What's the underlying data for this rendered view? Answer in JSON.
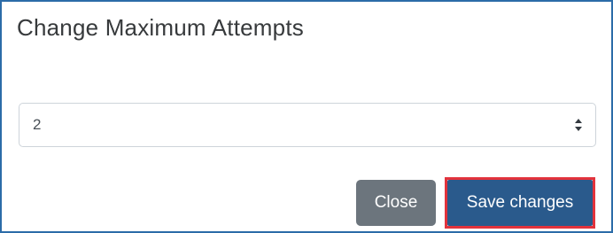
{
  "modal": {
    "title": "Change Maximum Attempts"
  },
  "attempts_select": {
    "value": "2",
    "arrow_icon": "sort-arrows-icon"
  },
  "footer": {
    "close_label": "Close",
    "save_label": "Save changes",
    "highlight_color": "#e2333c",
    "save_color": "#2a5a8c",
    "close_color": "#6c757d"
  }
}
